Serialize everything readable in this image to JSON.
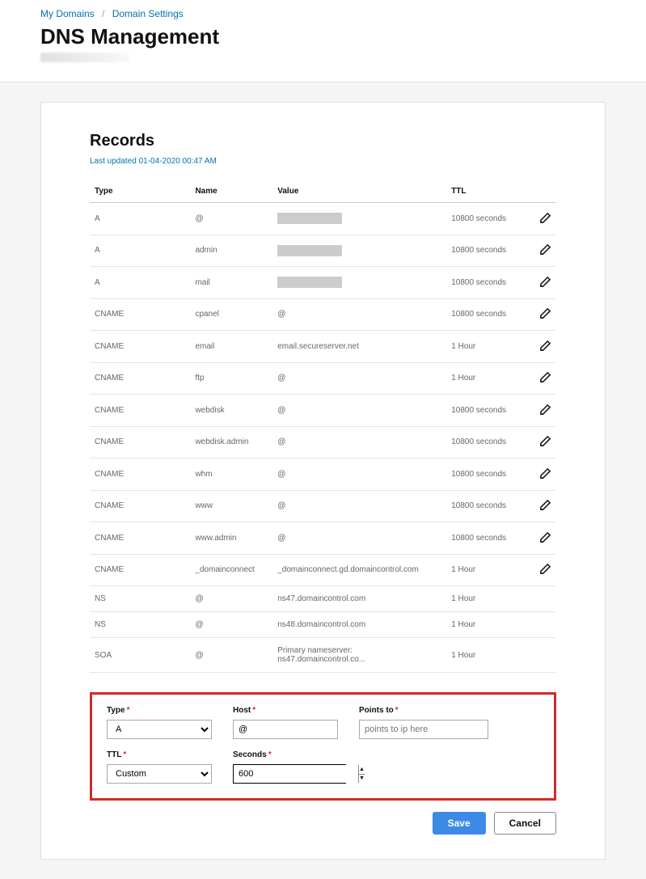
{
  "breadcrumb": {
    "item1": "My Domains",
    "item2": "Domain Settings"
  },
  "page_title": "DNS Management",
  "records_title": "Records",
  "last_updated": "Last updated 01-04-2020 00:47 AM",
  "columns": {
    "type": "Type",
    "name": "Name",
    "value": "Value",
    "ttl": "TTL"
  },
  "rows": [
    {
      "type": "A",
      "name": "@",
      "value": "",
      "redacted": true,
      "ttl": "10800 seconds",
      "editable": true
    },
    {
      "type": "A",
      "name": "admin",
      "value": "",
      "redacted": true,
      "ttl": "10800 seconds",
      "editable": true
    },
    {
      "type": "A",
      "name": "mail",
      "value": "",
      "redacted": true,
      "ttl": "10800 seconds",
      "editable": true
    },
    {
      "type": "CNAME",
      "name": "cpanel",
      "value": "@",
      "ttl": "10800 seconds",
      "editable": true
    },
    {
      "type": "CNAME",
      "name": "email",
      "value": "email.secureserver.net",
      "ttl": "1 Hour",
      "editable": true
    },
    {
      "type": "CNAME",
      "name": "ftp",
      "value": "@",
      "ttl": "1 Hour",
      "editable": true
    },
    {
      "type": "CNAME",
      "name": "webdisk",
      "value": "@",
      "ttl": "10800 seconds",
      "editable": true
    },
    {
      "type": "CNAME",
      "name": "webdisk.admin",
      "value": "@",
      "ttl": "10800 seconds",
      "editable": true
    },
    {
      "type": "CNAME",
      "name": "whm",
      "value": "@",
      "ttl": "10800 seconds",
      "editable": true
    },
    {
      "type": "CNAME",
      "name": "www",
      "value": "@",
      "ttl": "10800 seconds",
      "editable": true
    },
    {
      "type": "CNAME",
      "name": "www.admin",
      "value": "@",
      "ttl": "10800 seconds",
      "editable": true
    },
    {
      "type": "CNAME",
      "name": "_domainconnect",
      "value": "_domainconnect.gd.domaincontrol.com",
      "ttl": "1 Hour",
      "editable": true
    },
    {
      "type": "NS",
      "name": "@",
      "value": "ns47.domaincontrol.com",
      "ttl": "1 Hour",
      "editable": false
    },
    {
      "type": "NS",
      "name": "@",
      "value": "ns48.domaincontrol.com",
      "ttl": "1 Hour",
      "editable": false
    },
    {
      "type": "SOA",
      "name": "@",
      "value": "Primary nameserver: ns47.domaincontrol.co...",
      "ttl": "1 Hour",
      "editable": false
    }
  ],
  "form": {
    "type_label": "Type",
    "host_label": "Host",
    "points_label": "Points to",
    "ttl_label": "TTL",
    "seconds_label": "Seconds",
    "type_value": "A",
    "host_value": "@",
    "points_placeholder": "points to ip here",
    "points_value": "",
    "ttl_value": "Custom",
    "seconds_value": "600"
  },
  "buttons": {
    "save": "Save",
    "cancel": "Cancel"
  },
  "req": "*"
}
